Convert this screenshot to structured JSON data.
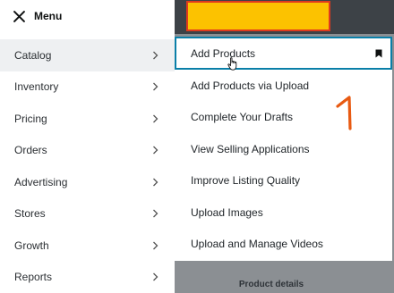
{
  "menu": {
    "title": "Menu",
    "close_icon": "close-icon",
    "items": [
      {
        "label": "Catalog",
        "selected": true
      },
      {
        "label": "Inventory",
        "selected": false
      },
      {
        "label": "Pricing",
        "selected": false
      },
      {
        "label": "Orders",
        "selected": false
      },
      {
        "label": "Advertising",
        "selected": false
      },
      {
        "label": "Stores",
        "selected": false
      },
      {
        "label": "Growth",
        "selected": false
      },
      {
        "label": "Reports",
        "selected": false
      }
    ]
  },
  "submenu": {
    "items": [
      {
        "label": "Add Products",
        "active": true,
        "icon": "bookmark-icon"
      },
      {
        "label": "Add Products via Upload"
      },
      {
        "label": "Complete Your Drafts"
      },
      {
        "label": "View Selling Applications"
      },
      {
        "label": "Improve Listing Quality"
      },
      {
        "label": "Upload Images"
      },
      {
        "label": "Upload and Manage Videos"
      }
    ]
  },
  "footer": {
    "label": "Product details"
  },
  "colors": {
    "accent": "#0a7fa8",
    "highlight_yellow": "#fcc200",
    "annotation_red": "#e03a1e",
    "overlay": "#8b8f93",
    "top_bar": "#3d4247"
  }
}
